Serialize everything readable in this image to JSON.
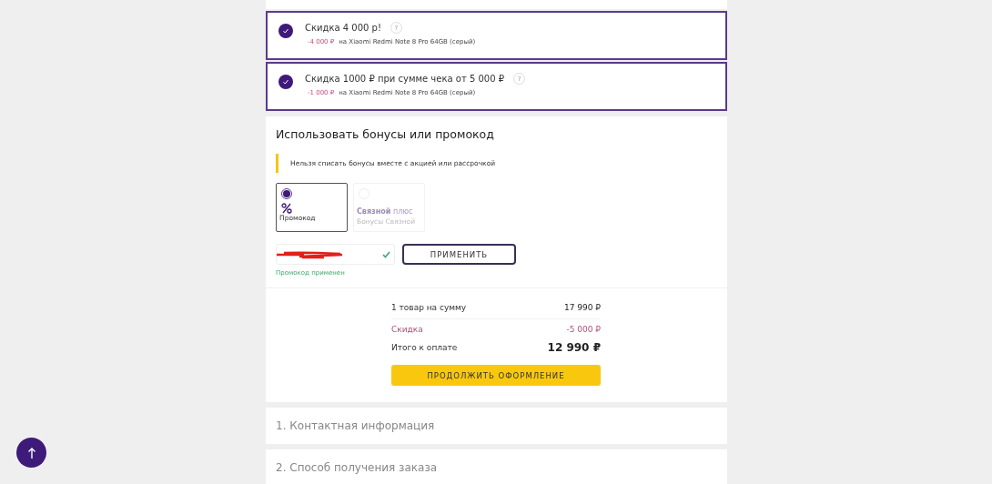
{
  "offers": [
    {
      "title": "Скидка 4 000 р!",
      "checked": true,
      "help": "?",
      "amount": "-4 000 ₽",
      "product": "на Xiaomi Redmi Note 8 Pro 64GB (серый)"
    },
    {
      "title": "Скидка 1000 ₽ при сумме чека от 5 000 ₽",
      "checked": true,
      "help": "?",
      "amount": "-1 000 ₽",
      "product": "на Xiaomi Redmi Note 8 Pro 64GB (серый)"
    }
  ],
  "bonus": {
    "title": "Использовать бонусы или промокод",
    "notice": "Нельзя списать бонусы вместе с акцией или рассрочкой",
    "options": [
      {
        "kind": "promo",
        "label": "Промокод",
        "selected": true,
        "disabled": false
      },
      {
        "kind": "bonus",
        "brand": "Связной",
        "brand_suffix": "плюс",
        "label": "Бонусы Связной",
        "selected": false,
        "disabled": true
      }
    ],
    "promo_applied": true,
    "apply_button": "ПРИМЕНИТЬ",
    "status": "Промокод применен"
  },
  "summary": {
    "rows": [
      {
        "kind": "normal",
        "label": "1 товар на сумму",
        "value": "17 990 ₽"
      },
      {
        "kind": "discount",
        "label": "Скидка",
        "value": "-5 000 ₽"
      },
      {
        "kind": "total",
        "label": "Итого к оплате",
        "value": "12 990 ₽"
      }
    ],
    "button": "ПРОДОЛЖИТЬ ОФОРМЛЕНИЕ"
  },
  "steps": [
    {
      "label": "1. Контактная информация"
    },
    {
      "label": "2. Способ получения заказа"
    }
  ]
}
